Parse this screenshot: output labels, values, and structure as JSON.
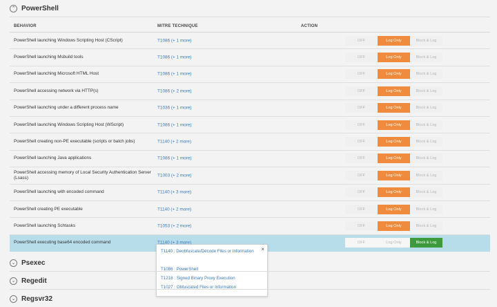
{
  "section": {
    "title": "PowerShell",
    "chevron": "chevron-up-icon"
  },
  "headers": {
    "behavior": "BEHAVIOR",
    "mitre": "MITRE TECHNIQUE",
    "action": "ACTION"
  },
  "action_labels": {
    "off": "OFF",
    "log": "Log Only",
    "block": "Block & Log"
  },
  "rows": [
    {
      "behavior": "PowerShell launching Windows Scripting Host (CScript)",
      "mitre": "T1086 (+ 1 more)",
      "action": "log"
    },
    {
      "behavior": "PowerShell launching Msbuild tools",
      "mitre": "T1086 (+ 1 more)",
      "action": "log"
    },
    {
      "behavior": "PowerShell launching Microsoft HTML Host",
      "mitre": "T1086 (+ 1 more)",
      "action": "log"
    },
    {
      "behavior": "PowerShell accessing network via HTTP(s)",
      "mitre": "T1086 (+ 2 more)",
      "action": "log"
    },
    {
      "behavior": "PowerShell launching under a different process name",
      "mitre": "T1036 (+ 1 more)",
      "action": "log"
    },
    {
      "behavior": "PowerShell launching Windows Scripting Host (WScript)",
      "mitre": "T1086 (+ 1 more)",
      "action": "log"
    },
    {
      "behavior": "PowerShell creating non-PE executable (scripts or batch jobs)",
      "mitre": "T1140 (+ 2 more)",
      "action": "log"
    },
    {
      "behavior": "PowerShell launching Java applications",
      "mitre": "T1086 (+ 1 more)",
      "action": "log"
    },
    {
      "behavior": "PowerShell accessing memory of Local Security Authentication Server (Lsass)",
      "mitre": "T1003 (+ 2 more)",
      "action": "log"
    },
    {
      "behavior": "PowerShell launching with encoded command",
      "mitre": "T1140 (+ 3 more)",
      "action": "log"
    },
    {
      "behavior": "PowerShell creating PE executable",
      "mitre": "T1140 (+ 2 more)",
      "action": "log"
    },
    {
      "behavior": "PowerShell launching Schtasks",
      "mitre": "T1053 (+ 2 more)",
      "action": "log"
    },
    {
      "behavior": "PowerShell executing base64 encoded command",
      "mitre": "T1140 (+ 3 more)",
      "action": "block"
    }
  ],
  "popup": {
    "close": "×",
    "items": [
      "T1140 : Deobfuscate/Decode Files or Information",
      "T1086 : PowerShell",
      "T1218 : Signed Binary Proxy Execution",
      "T1027 : Obfuscated Files or Information"
    ]
  },
  "collapsed_sections": [
    {
      "title": "Psexec"
    },
    {
      "title": "Regedit"
    },
    {
      "title": "Regsvr32"
    }
  ],
  "colors": {
    "orange": "#f08a3c",
    "green": "#3d9a3d",
    "link": "#3a7abf",
    "selected_row": "#b7dcea"
  }
}
